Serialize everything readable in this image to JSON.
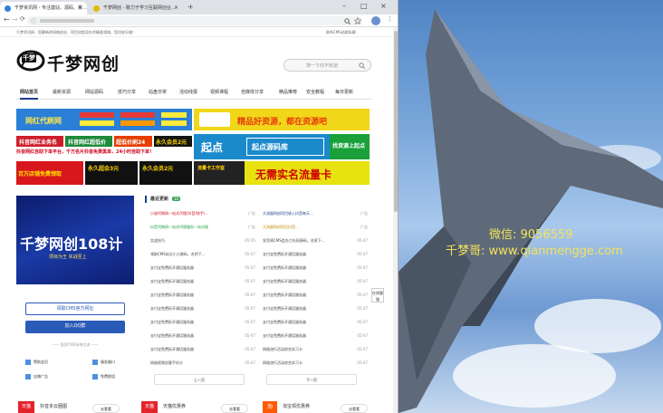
{
  "browser": {
    "tabs": [
      {
        "label": "千梦资讯网 - 专注建站、源码、技…"
      },
      {
        "label": "千梦网创 - 致力于学习互联网创业…"
      }
    ],
    "new_tab_symbol": "+",
    "close_symbol": "×",
    "window_controls": [
      "–",
      "□",
      "×"
    ],
    "nav_symbols": [
      "←",
      "→",
      "⟳"
    ],
    "url_lock_symbol": "ⓘ"
  },
  "site": {
    "top_notice_left": "千梦资讯网 - 您最新的网络创业、项目流程及技术精准领域，您坊安乐城！",
    "top_notice_right": "联系CMS站群私聊",
    "logo_text": "千梦网创",
    "logo_badge": "千梦",
    "search_placeholder": "搜一下你不知道",
    "nav": [
      "网站首页",
      "最新资源",
      "网站源码",
      "技巧分享",
      "站盘日常",
      "活动线报",
      "视频课程",
      "自媒体分享",
      "精品推荐",
      "安全教程",
      "每日更新"
    ],
    "banners": [
      {
        "text": "网红代刷网",
        "bg": "#2b7fd6",
        "color": "#ffe84d"
      },
      {
        "text": "精品好资源，都在资源吧",
        "bg": "#f1d71a",
        "color": "#e83b0c"
      },
      {
        "text": "抖音网红业务名",
        "bg": "#cf1e2b",
        "color": "#ffffff"
      },
      {
        "text": "抖音网红超低价",
        "bg": "#1e8a3a",
        "color": "#ffffff"
      },
      {
        "text": "超低价刷24",
        "bg": "#e73d00",
        "color": "#ffffff"
      },
      {
        "text": "永久会员2元",
        "bg": "#141414",
        "color": "#ffd800"
      },
      {
        "text": "起点",
        "bg": "#1b8acb",
        "color": "#ffffff"
      },
      {
        "text": "起点源码库",
        "bg": "#1b8acb",
        "color": "#ffffff"
      },
      {
        "text": "找资源上起点",
        "bg": "#19a03b",
        "color": "#ffffff"
      },
      {
        "text": "百万店铺免费领取",
        "bg": "#d8171d",
        "color": "#ffe600"
      },
      {
        "text": "永久超会3元",
        "bg": "#111111",
        "color": "#ffd200"
      },
      {
        "text": "永久会员2元",
        "bg": "#111111",
        "color": "#ffd200"
      },
      {
        "text": "流量卡工作室",
        "bg": "#e8e210",
        "color": "#d00000"
      },
      {
        "text": "无需实名流量卡",
        "bg": "#e8e210",
        "color": "#d00000"
      }
    ],
    "promo_red_line": "抖音网红自助下单平台，千万名片抖音免费黑单，24小时自助下单！",
    "sidebar_banner_text": "千梦网创108计",
    "sidebar_banner_sub": "项目为王  实战至上",
    "sidebar_btn1": "领取CMS官方网址",
    "sidebar_btn2": "加入QQ群",
    "sidebar_divider": "—— 投资CMS系统交流 ——",
    "sidebar_links": [
      "赞助会员",
      "服务服口",
      "店铺广告",
      "免费群组"
    ],
    "news_title": "最近更新",
    "news_badge": "10",
    "news_left": [
      {
        "t": "小说代刷网一站式代理/抖音/快手/…",
        "d": "广告"
      },
      {
        "t": "抖音代刷网一站式代理服务一站对接",
        "d": "广告"
      },
      {
        "t": "实战技巧",
        "d": "05-05"
      },
      {
        "t": "领取CMS站点小刀源码，名师下…",
        "d": "05-07"
      },
      {
        "t": "支付宝免费拆开通话服务器",
        "d": "05-07"
      },
      {
        "t": "支付宝免费拆开通话服务器",
        "d": "05-07"
      },
      {
        "t": "支付宝免费拆开通话服务器",
        "d": "05-07"
      },
      {
        "t": "支付宝免费拆开通话服务器",
        "d": "05-07"
      },
      {
        "t": "支付宝免费拆开通话服务器",
        "d": "05-07"
      },
      {
        "t": "支付宝免费拆开通话服务器",
        "d": "05-07"
      },
      {
        "t": "支付宝免费拆开通话服务器",
        "d": "05-07"
      },
      {
        "t": "网络视频创客手机卡",
        "d": "05-07"
      }
    ],
    "news_right": [
      {
        "t": "大流量网创项目收入抖音每天…",
        "d": "广告"
      },
      {
        "t": "大流量网创项目抖音…",
        "d": "广告"
      },
      {
        "t": "发官网CMS会办刀光网源码，名家下…",
        "d": "05-07"
      },
      {
        "t": "支付宝免费拆开通话服务器",
        "d": "05-07"
      },
      {
        "t": "支付宝免费拆开通话服务器",
        "d": "05-07"
      },
      {
        "t": "支付宝免费拆开通话服务器",
        "d": "05-07"
      },
      {
        "t": "支付宝免费拆开通话服务器",
        "d": "05-07"
      },
      {
        "t": "支付宝免费拆开通话服务器",
        "d": "05-07"
      },
      {
        "t": "支付宝免费拆开通话服务器",
        "d": "05-07"
      },
      {
        "t": "支付宝免费拆开通话服务器",
        "d": "05-07"
      },
      {
        "t": "网络流行活动综合实习卡",
        "d": "05-07"
      },
      {
        "t": "网络流行活动综合实习卡",
        "d": "05-07"
      }
    ],
    "prev_label": "上一页",
    "next_label": "下一页",
    "float_label": "在线客服",
    "bottom_cards": [
      {
        "icon": "天猫",
        "title": "抖音多云圈图",
        "btn": "去看看",
        "bg": "#e4242b"
      },
      {
        "icon": "天猫",
        "title": "天猫优惠券",
        "btn": "去看看",
        "bg": "#e4242b"
      },
      {
        "icon": "淘",
        "title": "淘宝领优惠券",
        "btn": "去看看",
        "bg": "#ff5a00"
      }
    ]
  },
  "wallpaper": {
    "wechat_text": "微信: 9056559",
    "site_text": "千梦哥: www.qianmengge.com"
  }
}
